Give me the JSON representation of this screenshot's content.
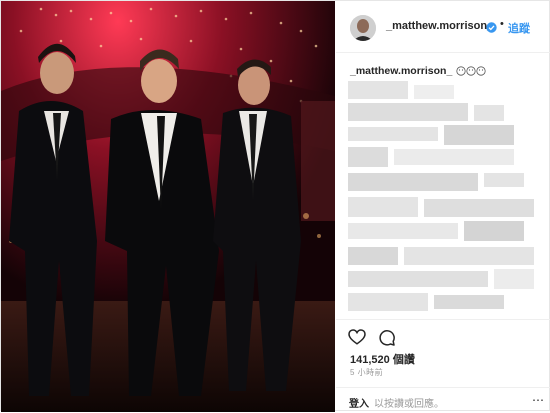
{
  "header": {
    "username": "_matthew.morrison_",
    "separator": "•",
    "follow_label": "追蹤"
  },
  "caption": {
    "username": "_matthew.morrison_",
    "emoji_icon": "face-emoji-icon"
  },
  "actions": {
    "likes": "141,520 個讚",
    "time_ago": "5 小時前"
  },
  "login": {
    "link": "登入",
    "rest": "以按讚或回應。",
    "more": "⋯"
  },
  "colors": {
    "accent": "#3897f0",
    "text": "#262626",
    "muted": "#999999"
  }
}
